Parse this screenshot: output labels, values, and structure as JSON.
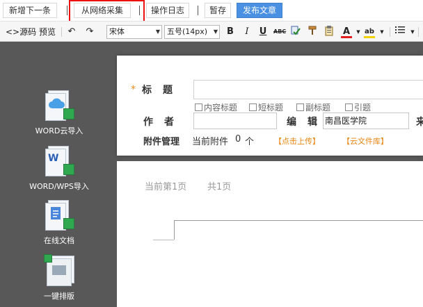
{
  "topbar": {
    "new_next": "新增下一条",
    "collect_web": "从网络采集",
    "operation_log": "操作日志",
    "save_draft": "暂存",
    "publish": "发布文章"
  },
  "toolbar": {
    "source": "<>源码",
    "preview": "预览",
    "font_family": "宋体",
    "font_size": "五号(14px)",
    "bold": "B",
    "italic": "I",
    "underline": "U",
    "strike": "ABC",
    "font_color": "A",
    "highlight": "ab"
  },
  "left_tools": [
    {
      "label": "WORD云导入"
    },
    {
      "label": "WORD/WPS导入"
    },
    {
      "label": "在线文档"
    },
    {
      "label": "一键排版"
    }
  ],
  "form": {
    "title_label": "标　题",
    "title_value": "",
    "checkbox_options": [
      "内容标题",
      "短标题",
      "副标题",
      "引题"
    ],
    "author_label": "作　者",
    "author_value": "",
    "editor_label": "编　辑",
    "editor_value": "南昌医学院",
    "source_label_partial": "来",
    "attachment_label": "附件管理",
    "current_attachments": "当前附件",
    "attachment_count": "0",
    "attachment_unit": "个",
    "upload_link": "【点击上传】",
    "cloud_library_link": "【云文件库】"
  },
  "document": {
    "current_page": "当前第1页",
    "total_pages": "共1页"
  },
  "colors": {
    "publish_bg": "#4a90e2",
    "highlight_border": "#e11111",
    "panel_dark": "#585858",
    "required_mark": "#f08a1c",
    "link_orange": "#e98511"
  }
}
